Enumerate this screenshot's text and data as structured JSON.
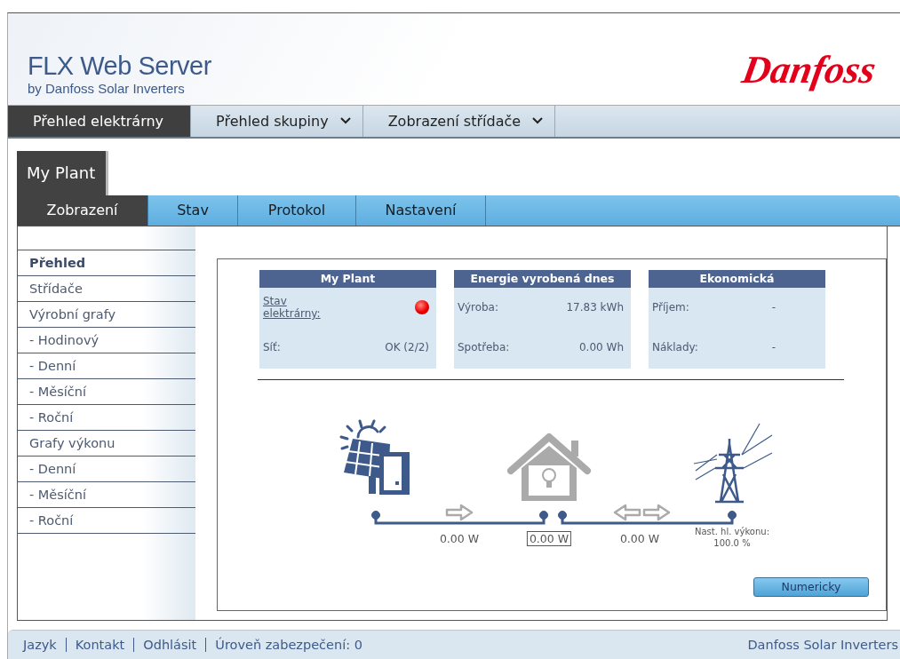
{
  "header": {
    "title": "FLX Web Server",
    "subtitle": "by Danfoss Solar Inverters",
    "logo": "Danfoss"
  },
  "nav_tabs": [
    {
      "label": "Přehled elektrárny",
      "selected": true,
      "dropdown": false
    },
    {
      "label": "Přehled skupiny",
      "selected": false,
      "dropdown": true
    },
    {
      "label": "Zobrazení střídače",
      "selected": false,
      "dropdown": true
    }
  ],
  "plant_tab": {
    "label": "My Plant",
    "selected": true
  },
  "sub_tabs": [
    {
      "label": "Zobrazení",
      "selected": true
    },
    {
      "label": "Stav",
      "selected": false
    },
    {
      "label": "Protokol",
      "selected": false
    },
    {
      "label": "Nastavení",
      "selected": false
    }
  ],
  "sidebar": {
    "items": [
      {
        "label": "Přehled",
        "selected": true
      },
      {
        "label": "Střídače",
        "selected": false
      },
      {
        "label": "Výrobní grafy",
        "selected": false
      },
      {
        "label": "- Hodinový",
        "selected": false
      },
      {
        "label": "- Denní",
        "selected": false
      },
      {
        "label": "- Měsíční",
        "selected": false
      },
      {
        "label": "- Roční",
        "selected": false
      },
      {
        "label": "Grafy výkonu",
        "selected": false
      },
      {
        "label": "- Denní",
        "selected": false
      },
      {
        "label": "- Měsíční",
        "selected": false
      },
      {
        "label": "- Roční",
        "selected": false
      }
    ]
  },
  "cards": [
    {
      "title": "My Plant",
      "rows": [
        {
          "kind": "status",
          "label": "Stav elektrárny:",
          "alarm": true
        },
        {
          "kind": "value",
          "label": "Síť:",
          "value": "OK (2/2)"
        }
      ]
    },
    {
      "title": "Energie vyrobená dnes",
      "rows": [
        {
          "kind": "value",
          "label": "Výroba:",
          "value": "17.83 kWh"
        },
        {
          "kind": "value",
          "label": "Spotřeba:",
          "value": "0.00 Wh"
        }
      ]
    },
    {
      "title": "Ekonomická",
      "rows": [
        {
          "kind": "value",
          "label": "Příjem:",
          "value": "-"
        },
        {
          "kind": "value",
          "label": "Náklady:",
          "value": "-"
        }
      ]
    }
  ],
  "flow": {
    "pv_power": "0.00 W",
    "house_power": "0.00 W",
    "grid_power": "0.00 W",
    "grid_limit_label": "Nast. hl. výkonu:",
    "grid_limit": "100.0 %"
  },
  "numeric_button": "Numericky",
  "footer": {
    "links": [
      "Jazyk",
      "Kontakt",
      "Odhlásit"
    ],
    "security": "Úroveň zabezpečení: 0",
    "brand": "Danfoss Solar Inverters"
  }
}
